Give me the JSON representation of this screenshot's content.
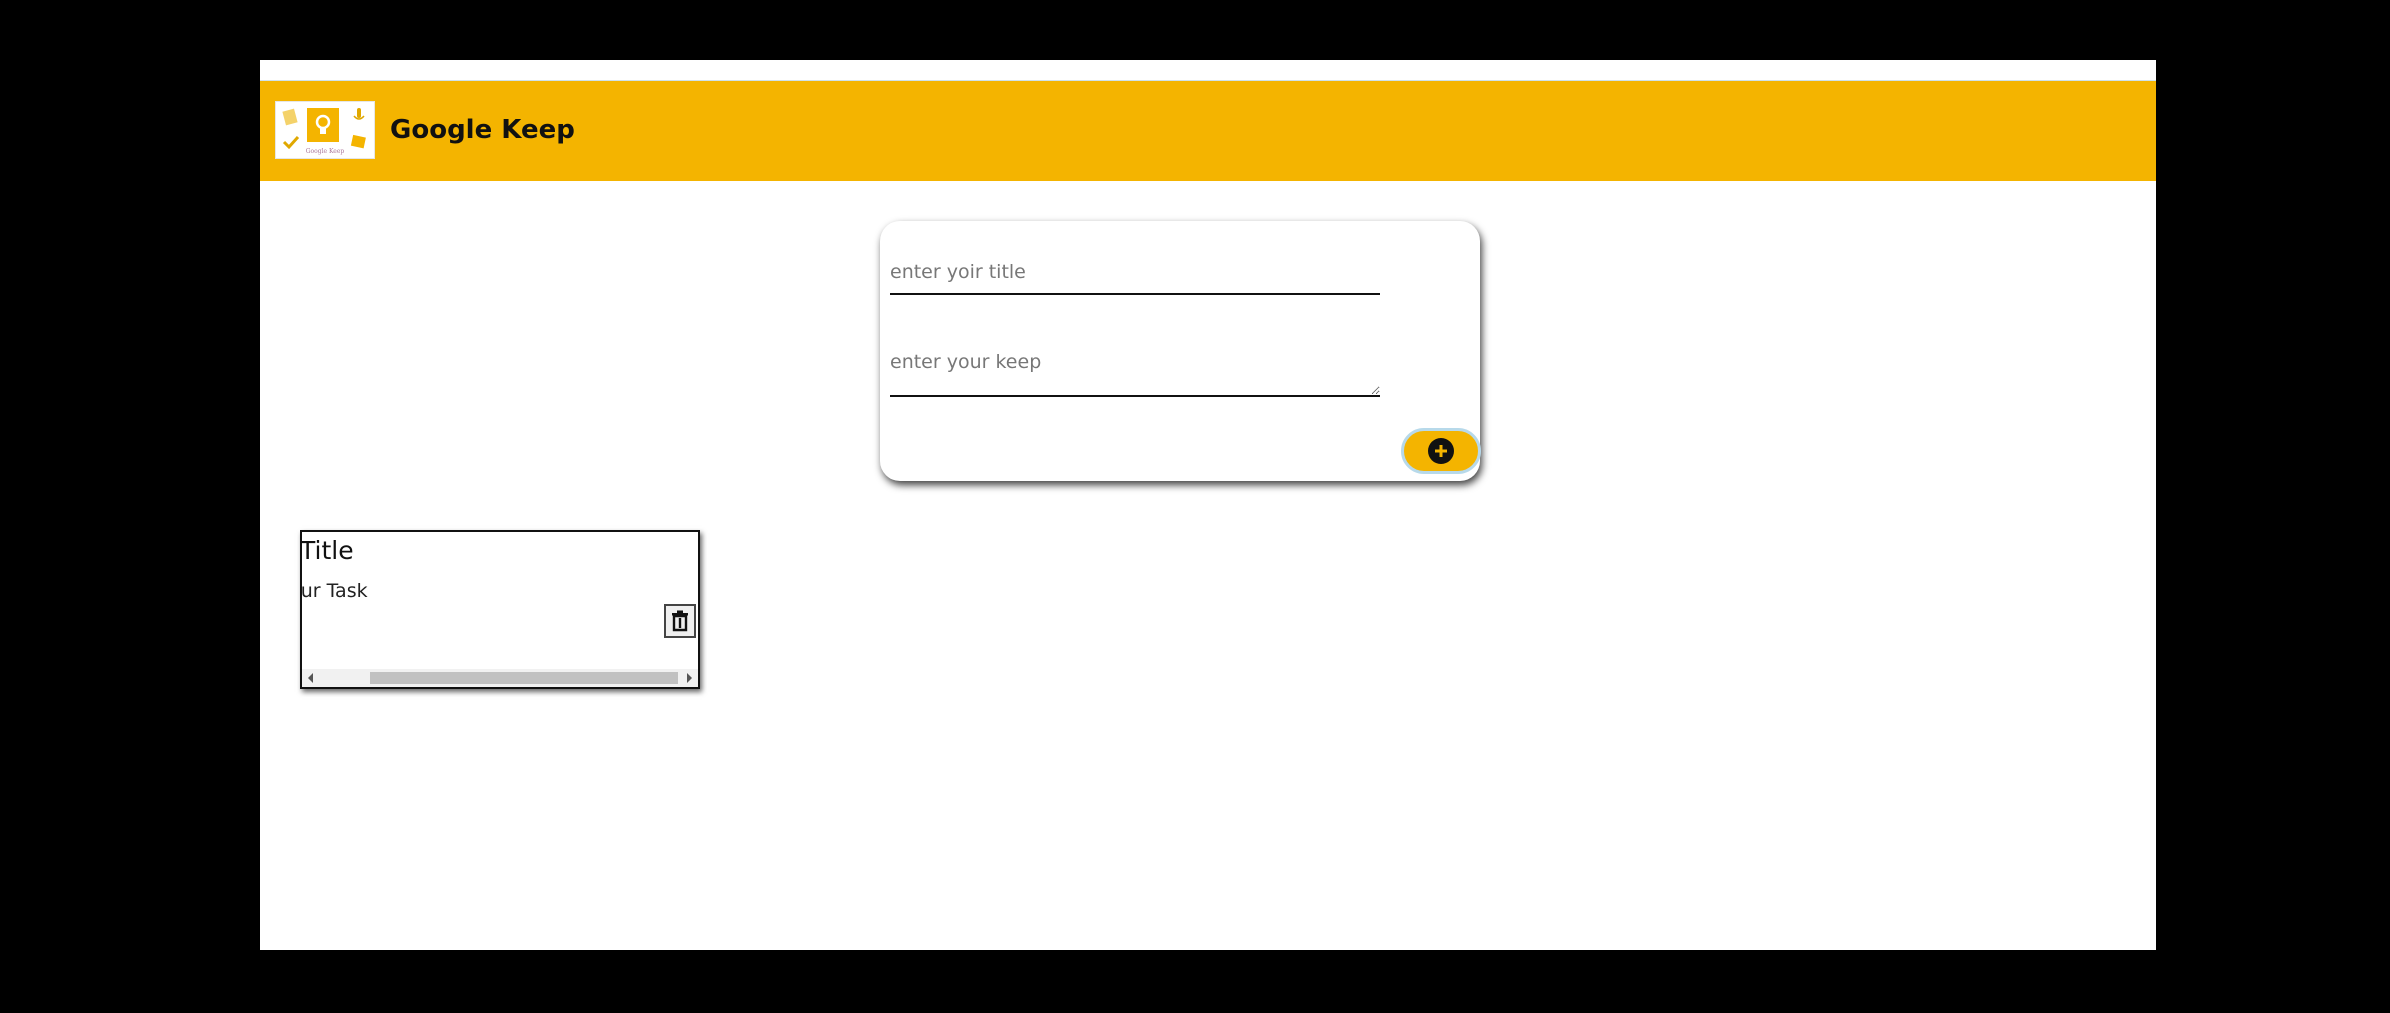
{
  "header": {
    "app_title": "Google Keep",
    "logo_caption": "Google Keep",
    "accent_color": "#f4b400"
  },
  "form": {
    "title_placeholder": "enter yoir title",
    "title_value": "",
    "keep_placeholder": "enter your keep",
    "keep_value": "",
    "add_icon": "plus-circle-icon"
  },
  "notes": [
    {
      "title": "Title",
      "body": "Your Task",
      "delete_icon": "trash-icon"
    }
  ]
}
